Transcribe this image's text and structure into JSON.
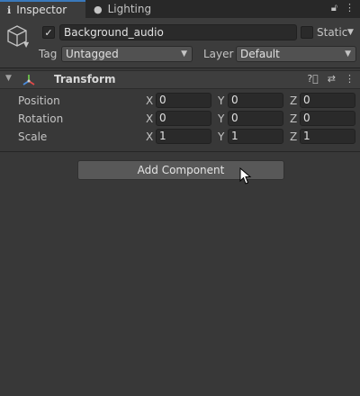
{
  "tabs": [
    {
      "label": "Inspector",
      "icon": "info-icon",
      "active": true
    },
    {
      "label": "Lighting",
      "icon": "lightbulb-icon",
      "active": false
    }
  ],
  "tab_controls": {
    "lock_icon": "lock-icon",
    "menu_icon": "kebab-menu-icon"
  },
  "object": {
    "active": true,
    "name": "Background_audio",
    "static_label": "Static",
    "static_checked": false,
    "tag_label": "Tag",
    "tag_value": "Untagged",
    "layer_label": "Layer",
    "layer_value": "Default"
  },
  "transform": {
    "title": "Transform",
    "position": {
      "label": "Position",
      "x": "0",
      "y": "0",
      "z": "0"
    },
    "rotation": {
      "label": "Rotation",
      "x": "0",
      "y": "0",
      "z": "0"
    },
    "scale": {
      "label": "Scale",
      "x": "1",
      "y": "1",
      "z": "1"
    },
    "axis_labels": {
      "x": "X",
      "y": "Y",
      "z": "Z"
    }
  },
  "add_component_label": "Add Component",
  "colors": {
    "background": "#383838",
    "tab_active_accent": "#3a79bb",
    "field_bg": "#2a2a2a",
    "button_bg": "#585858"
  }
}
